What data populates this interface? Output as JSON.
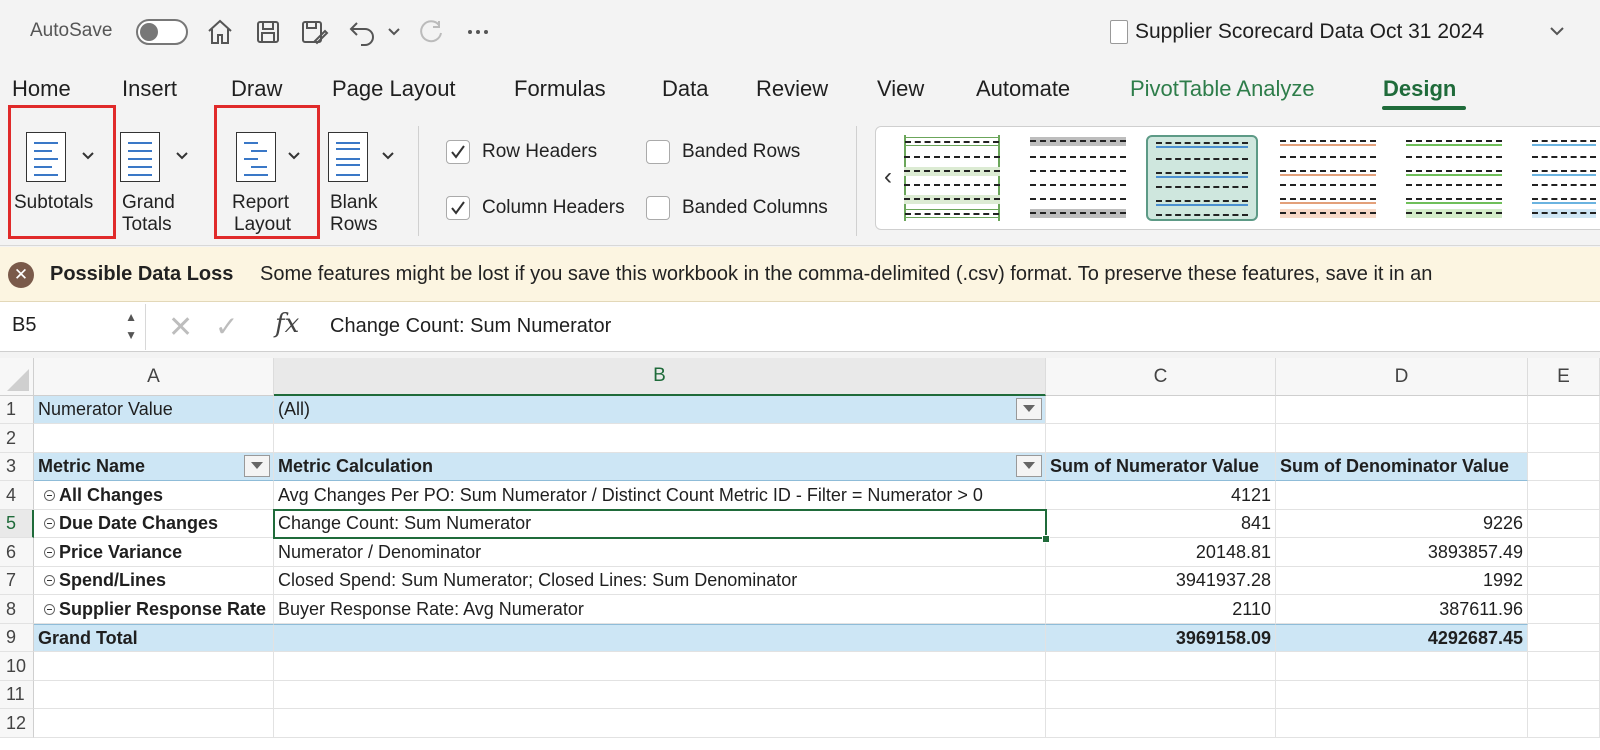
{
  "titlebar": {
    "autosave_label": "AutoSave",
    "autosave_on": false,
    "document_title": "Supplier Scorecard Data Oct 31 2024",
    "icons": [
      "home-icon",
      "save-icon",
      "save-as-icon",
      "undo-icon",
      "redo-icon",
      "more-icon"
    ]
  },
  "tabs": [
    {
      "label": "Home"
    },
    {
      "label": "Insert"
    },
    {
      "label": "Draw"
    },
    {
      "label": "Page Layout"
    },
    {
      "label": "Formulas"
    },
    {
      "label": "Data"
    },
    {
      "label": "Review"
    },
    {
      "label": "View"
    },
    {
      "label": "Automate"
    },
    {
      "label": "PivotTable Analyze"
    },
    {
      "label": "Design"
    }
  ],
  "ribbon": {
    "subtotals": "Subtotals",
    "grand_totals_1": "Grand",
    "grand_totals_2": "Totals",
    "report_layout_1": "Report",
    "report_layout_2": "Layout",
    "blank_rows_1": "Blank",
    "blank_rows_2": "Rows",
    "row_headers": "Row Headers",
    "column_headers": "Column Headers",
    "banded_rows": "Banded Rows",
    "banded_columns": "Banded Columns",
    "row_headers_checked": true,
    "column_headers_checked": true,
    "banded_rows_checked": false,
    "banded_columns_checked": false
  },
  "alert": {
    "title": "Possible Data Loss",
    "message": "Some features might be lost if you save this workbook in the comma-delimited (.csv) format. To preserve these features, save it in an"
  },
  "formula_bar": {
    "name_box": "B5",
    "fx": "fx",
    "content": "Change Count: Sum Numerator"
  },
  "grid": {
    "columns": [
      "A",
      "B",
      "C",
      "D",
      "E"
    ],
    "rows": [
      "1",
      "2",
      "3",
      "4",
      "5",
      "6",
      "7",
      "8",
      "9",
      "10",
      "11",
      "12"
    ],
    "filter_label": "Numerator Value",
    "filter_value": "(All)",
    "headers": [
      "Metric Name",
      "Metric Calculation",
      "Sum of Numerator Value",
      "Sum of Denominator Value"
    ],
    "data_rows": [
      {
        "name": "All Changes",
        "calc": "Avg Changes Per PO: Sum Numerator / Distinct Count Metric ID - Filter = Numerator > 0",
        "num": "4121",
        "den": ""
      },
      {
        "name": "Due Date Changes",
        "calc": "Change Count: Sum Numerator",
        "num": "841",
        "den": "9226"
      },
      {
        "name": "Price Variance",
        "calc": "Numerator / Denominator",
        "num": "20148.81",
        "den": "3893857.49"
      },
      {
        "name": "Spend/Lines",
        "calc": "Closed Spend: Sum Numerator; Closed Lines: Sum Denominator",
        "num": "3941937.28",
        "den": "1992"
      },
      {
        "name": "Supplier Response Rate",
        "calc": "Buyer Response Rate: Avg Numerator",
        "num": "2110",
        "den": "387611.96"
      }
    ],
    "grand_total": {
      "label": "Grand Total",
      "num": "3969158.09",
      "den": "4292687.45"
    }
  },
  "colors": {
    "accent_green": "#1f6b3a",
    "pivot_blue": "#cde6f5",
    "highlight_red": "#e02a2a",
    "alert_bg": "#fcf5e1"
  }
}
